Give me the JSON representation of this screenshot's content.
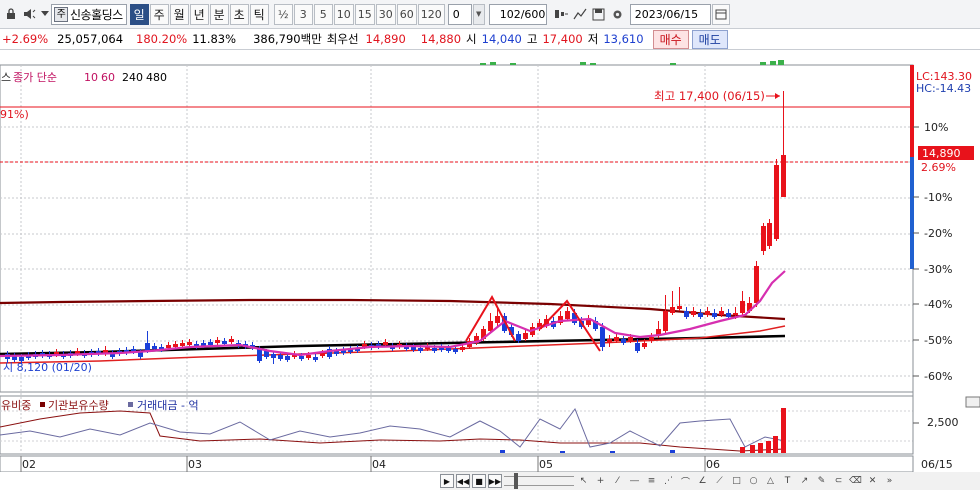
{
  "toolbar": {
    "stock_name": "신송홀딩스",
    "stock_prefix_icon": "주",
    "periods": [
      {
        "label": "일",
        "active": true
      },
      {
        "label": "주",
        "active": false
      },
      {
        "label": "월",
        "active": false
      },
      {
        "label": "년",
        "active": false
      },
      {
        "label": "분",
        "active": false
      },
      {
        "label": "초",
        "active": false
      },
      {
        "label": "틱",
        "active": false
      }
    ],
    "intervals": [
      "½",
      "3",
      "5",
      "10",
      "15",
      "30",
      "60",
      "120"
    ],
    "interval_value": "0",
    "count_value": "102",
    "count_total": "/600",
    "date_value": "2023/06/15"
  },
  "info": {
    "change_rate": "+2.69%",
    "volume": "25,057,064",
    "volume_ratio": "180.20%",
    "turnover": "11.83%",
    "amount": "386,790백만",
    "best_label": "최우선",
    "best_ask": "14,890",
    "best_bid": "14,880",
    "open_label": "시",
    "open": "14,040",
    "high_label": "고",
    "high": "17,400",
    "low_label": "저",
    "low": "13,610",
    "buy_label": "매수",
    "sell_label": "매도"
  },
  "legend": {
    "prefix": "스",
    "ma_label": "종가 단순",
    "ma_periods": [
      "10",
      "60",
      "240",
      "480"
    ],
    "ma_colors": [
      "#c01060",
      "#c01060",
      "#000000",
      "#7a0000"
    ]
  },
  "annotations": {
    "left_pct": "91%)",
    "high_note": "최고 17,400 (06/15)",
    "low_note": "시 8,120 (01/20)",
    "lc": "LC:143.30",
    "hc": "HC:-14.43",
    "current_price": "14,890",
    "current_pct": "2.69%"
  },
  "axis": {
    "pct_labels": [
      "10%",
      "-10%",
      "-20%",
      "-30%",
      "-40%",
      "-50%",
      "-60%"
    ],
    "months": [
      "02",
      "03",
      "04",
      "05",
      "06"
    ],
    "date_end": "06/15",
    "volume_scale": "2,500"
  },
  "volume_legend": {
    "item1": "유비중",
    "item2": "기관보유수량",
    "item3": "거래대금 - 억"
  },
  "colors": {
    "up": "#e8121b",
    "down": "#1a3fd9",
    "ma10": "#d62fb0",
    "ma60": "#e02020",
    "ma240": "#000000",
    "ma480": "#7a0000",
    "pattern": "#e8121b",
    "lc": "#e8121b",
    "hc": "#2060d0"
  }
}
